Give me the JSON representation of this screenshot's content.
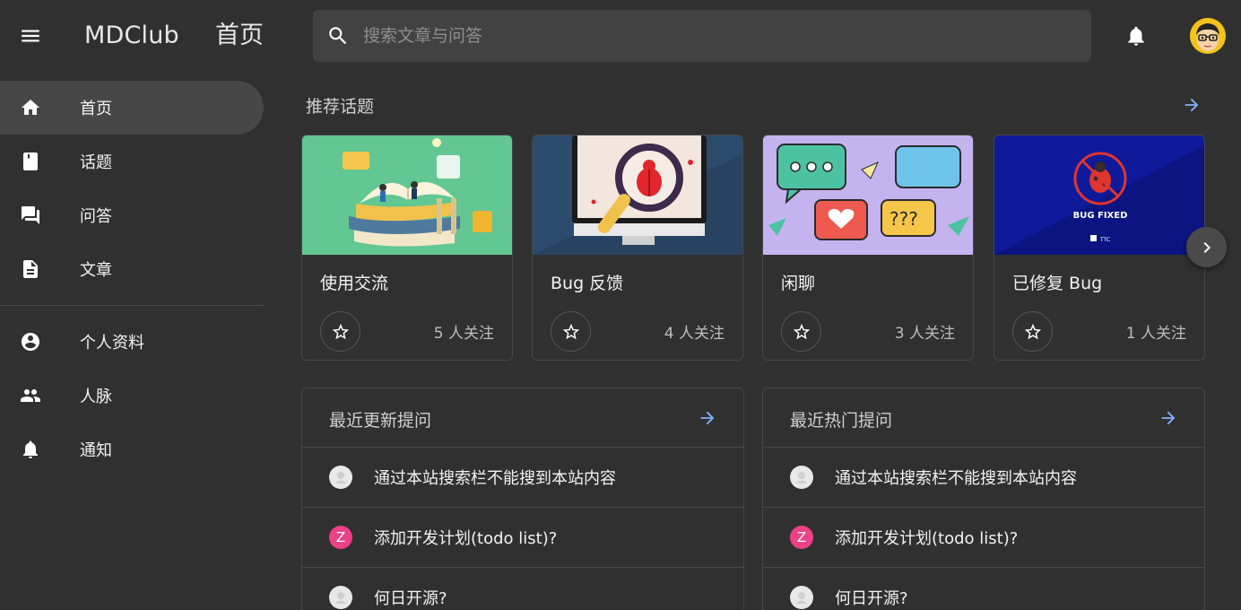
{
  "app": {
    "brand": "MDClub",
    "page_title": "首页",
    "search_placeholder": "搜索文章与问答",
    "accent": "#82b1ff"
  },
  "drawer": {
    "items": [
      {
        "label": "首页",
        "icon": "home-icon",
        "active": true
      },
      {
        "label": "话题",
        "icon": "book-icon"
      },
      {
        "label": "问答",
        "icon": "forum-icon"
      },
      {
        "label": "文章",
        "icon": "description-icon"
      },
      {
        "label": "个人资料",
        "icon": "account-circle-icon"
      },
      {
        "label": "人脉",
        "icon": "people-icon"
      },
      {
        "label": "通知",
        "icon": "notifications-icon"
      }
    ]
  },
  "topics": {
    "title": "推荐话题",
    "cards": [
      {
        "name": "使用交流",
        "followers": "5 人关注"
      },
      {
        "name": "Bug 反馈",
        "followers": "4 人关注"
      },
      {
        "name": "闲聊",
        "followers": "3 人关注"
      },
      {
        "name": "已修复 Bug",
        "followers": "1 人关注",
        "image_text": "BUG FIXED",
        "image_logo": "TTC"
      }
    ]
  },
  "recent_questions": {
    "title": "最近更新提问",
    "items": [
      {
        "title": "通过本站搜索栏不能搜到本站内容",
        "avatar": "gray"
      },
      {
        "title": "添加开发计划(todo list)?",
        "avatar": "pink",
        "avatar_letter": "Z"
      },
      {
        "title": "何日开源?",
        "avatar": "gray"
      }
    ]
  },
  "hot_questions": {
    "title": "最近热门提问",
    "items": [
      {
        "title": "通过本站搜索栏不能搜到本站内容",
        "avatar": "gray"
      },
      {
        "title": "添加开发计划(todo list)?",
        "avatar": "pink",
        "avatar_letter": "Z"
      },
      {
        "title": "何日开源?",
        "avatar": "gray"
      }
    ]
  }
}
